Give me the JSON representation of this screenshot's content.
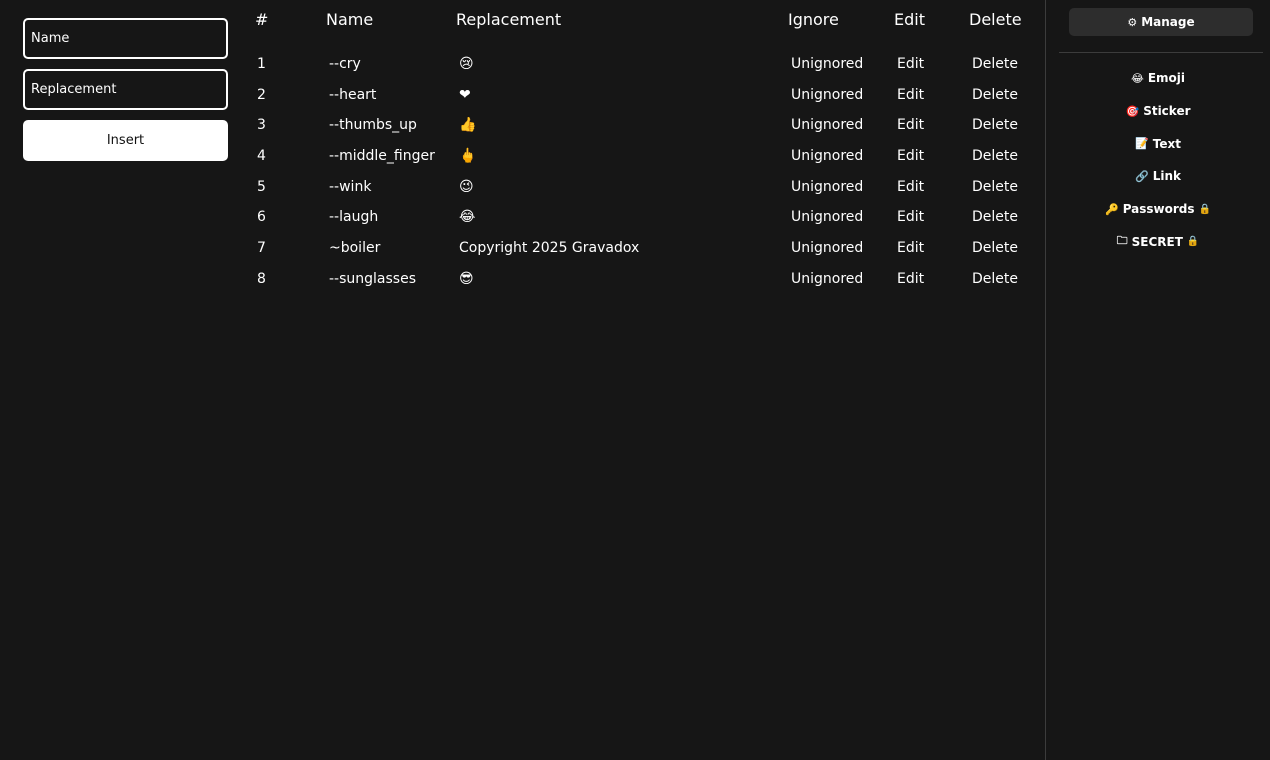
{
  "form": {
    "name_placeholder": "Name",
    "replacement_placeholder": "Replacement",
    "insert_label": "Insert"
  },
  "table": {
    "headers": [
      "#",
      "Name",
      "Replacement",
      "Ignore",
      "Edit",
      "Delete"
    ],
    "rows": [
      {
        "num": "1",
        "name": "--cry",
        "replacement": "😢",
        "ignore": "Unignored",
        "edit": "Edit",
        "delete": "Delete"
      },
      {
        "num": "2",
        "name": "--heart",
        "replacement": "❤",
        "ignore": "Unignored",
        "edit": "Edit",
        "delete": "Delete"
      },
      {
        "num": "3",
        "name": "--thumbs_up",
        "replacement": "👍",
        "ignore": "Unignored",
        "edit": "Edit",
        "delete": "Delete"
      },
      {
        "num": "4",
        "name": "--middle_finger",
        "replacement": "🖕",
        "ignore": "Unignored",
        "edit": "Edit",
        "delete": "Delete"
      },
      {
        "num": "5",
        "name": "--wink",
        "replacement": "😉",
        "ignore": "Unignored",
        "edit": "Edit",
        "delete": "Delete"
      },
      {
        "num": "6",
        "name": "--laugh",
        "replacement": "😂",
        "ignore": "Unignored",
        "edit": "Edit",
        "delete": "Delete"
      },
      {
        "num": "7",
        "name": "~boiler",
        "replacement": "Copyright 2025 Gravadox",
        "ignore": "Unignored",
        "edit": "Edit",
        "delete": "Delete"
      },
      {
        "num": "8",
        "name": "--sunglasses",
        "replacement": "😎",
        "ignore": "Unignored",
        "edit": "Edit",
        "delete": "Delete"
      }
    ]
  },
  "sidebar": {
    "manage": {
      "icon": "⚙",
      "label": "Manage"
    },
    "items": [
      {
        "icon": "😂",
        "label": "Emoji",
        "icon_name": "emoji-icon"
      },
      {
        "icon": "🎯",
        "label": "Sticker",
        "icon_name": "sticker-icon"
      },
      {
        "icon": "📝",
        "label": "Text",
        "icon_name": "text-icon"
      },
      {
        "icon": "🔗",
        "label": "Link",
        "icon_name": "link-icon"
      },
      {
        "icon": "🔑",
        "label": "Passwords",
        "icon_name": "key-icon",
        "locked": true
      },
      {
        "icon": "🗀",
        "label": "SECRET",
        "icon_name": "folder-icon",
        "locked": true
      }
    ]
  },
  "colors": {
    "background": "#161616",
    "text": "#ffffff",
    "button_bg": "#2d2d2d"
  }
}
